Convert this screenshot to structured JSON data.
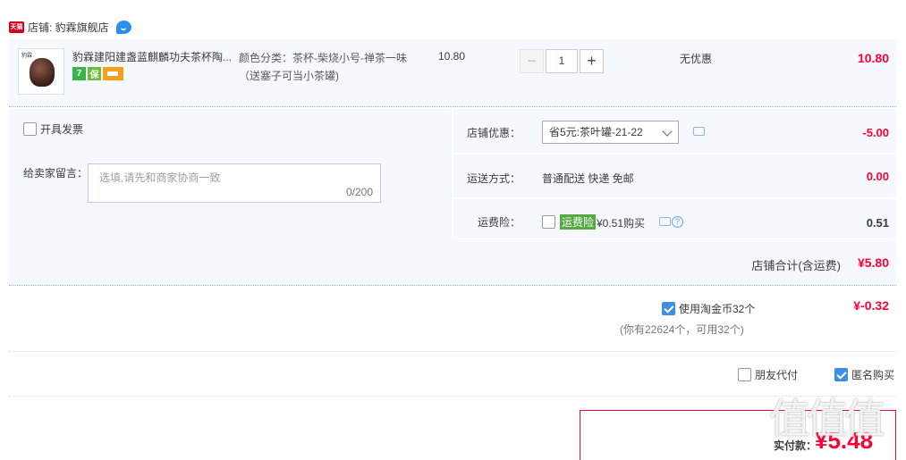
{
  "shop": {
    "badge_text": "天猫",
    "label": "店铺: 豹霖旗舰店"
  },
  "item": {
    "thumb_brand": "豹霖",
    "title": "豹霖建阳建盏蓝麒麟功夫茶杯陶...",
    "badges": {
      "seven_days": "7",
      "guarantee": "保"
    },
    "sku": "颜色分类：茶杯-柴烧小号-禅茶一味 （送塞子可当小茶罐)",
    "unit_price": "10.80",
    "quantity": "1",
    "qty_minus": "−",
    "qty_plus": "+",
    "discount": "无优惠",
    "subtotal": "10.80"
  },
  "options": {
    "invoice_label": "开具发票",
    "message_label": "给卖家留言：",
    "message_placeholder": "选填,请先和商家协商一致",
    "message_count": "0/200"
  },
  "shop_discount": {
    "label": "店铺优惠：",
    "selected": "省5元:茶叶罐-21-22",
    "value": "-5.00"
  },
  "shipping": {
    "label": "运送方式：",
    "method": "普通配送 快递 免邮",
    "value": "0.00"
  },
  "insurance": {
    "label": "运费险：",
    "tag": "运费险",
    "price": "¥0.51购买",
    "help": "?",
    "value": "0.51"
  },
  "shop_total": {
    "label": "店铺合计(含运费)",
    "value": "¥5.80"
  },
  "coins": {
    "label": "使用淘金币32个",
    "note": "(你有22624个，可用32个)",
    "value": "¥-0.32"
  },
  "checkout_options": {
    "friend_pay": "朋友代付",
    "anonymous": "匿名购买"
  },
  "payment": {
    "label": "实付款：",
    "value": "¥5.48"
  },
  "watermark": "值值值"
}
